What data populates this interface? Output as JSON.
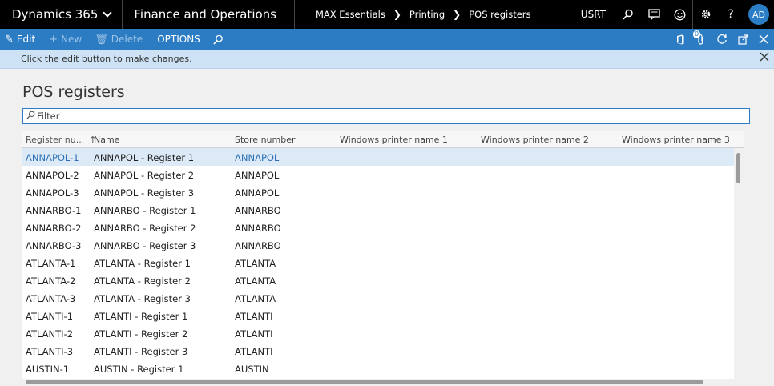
{
  "topbar": {
    "app": "Dynamics 365",
    "module": "Finance and Operations",
    "breadcrumbs": [
      "MAX Essentials",
      "Printing",
      "POS registers"
    ],
    "company": "USRT",
    "avatar": "AD"
  },
  "actions": {
    "edit": "Edit",
    "new": "New",
    "delete": "Delete",
    "options": "OPTIONS"
  },
  "message": "Click the edit button to make changes.",
  "page": {
    "title": "POS registers",
    "filter_placeholder": "Filter"
  },
  "grid": {
    "columns": [
      "Register nu...",
      "Name",
      "Store number",
      "Windows printer name 1",
      "Windows printer name 2",
      "Windows printer name 3"
    ],
    "rows": [
      [
        "ANNAPOL-1",
        "ANNAPOL - Register 1",
        "ANNAPOL"
      ],
      [
        "ANNAPOL-2",
        "ANNAPOL - Register 2",
        "ANNAPOL"
      ],
      [
        "ANNAPOL-3",
        "ANNAPOL - Register 3",
        "ANNAPOL"
      ],
      [
        "ANNARBO-1",
        "ANNARBO - Register 1",
        "ANNARBO"
      ],
      [
        "ANNARBO-2",
        "ANNARBO - Register 2",
        "ANNARBO"
      ],
      [
        "ANNARBO-3",
        "ANNARBO - Register 3",
        "ANNARBO"
      ],
      [
        "ATLANTA-1",
        "ATLANTA - Register 1",
        "ATLANTA"
      ],
      [
        "ATLANTA-2",
        "ATLANTA - Register 2",
        "ATLANTA"
      ],
      [
        "ATLANTA-3",
        "ATLANTA - Register 3",
        "ATLANTA"
      ],
      [
        "ATLANTI-1",
        "ATLANTI - Register 1",
        "ATLANTI"
      ],
      [
        "ATLANTI-2",
        "ATLANTI - Register 2",
        "ATLANTI"
      ],
      [
        "ATLANTI-3",
        "ATLANTI - Register 3",
        "ATLANTI"
      ],
      [
        "AUSTIN-1",
        "AUSTIN - Register 1",
        "AUSTIN"
      ]
    ]
  }
}
